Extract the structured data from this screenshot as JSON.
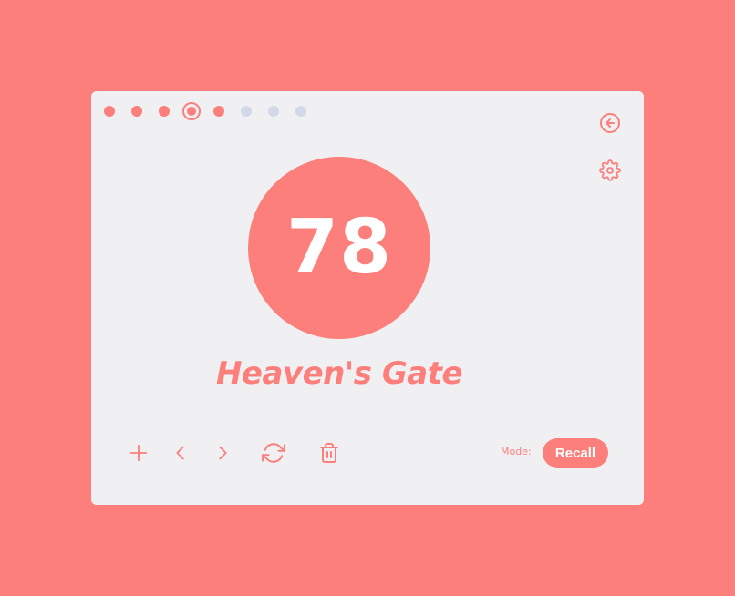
{
  "progress": {
    "total": 8,
    "current_index": 3,
    "steps": [
      "done",
      "done",
      "done",
      "current",
      "done",
      "todo",
      "todo",
      "todo"
    ]
  },
  "card": {
    "score": "78",
    "title": "Heaven's Gate"
  },
  "mode": {
    "label": "Mode:",
    "value": "Recall"
  },
  "icons": {
    "back": "arrow-left-circle-icon",
    "settings": "gear-icon",
    "add": "plus-icon",
    "previous": "chevron-left-icon",
    "next": "chevron-right-icon",
    "refresh": "refresh-icon",
    "delete": "trash-icon"
  },
  "colors": {
    "accent": "#fd7f7c",
    "card_background": "#f0f0f3",
    "inactive_dot": "#d3d8e8",
    "text_on_accent": "#ffffff"
  }
}
